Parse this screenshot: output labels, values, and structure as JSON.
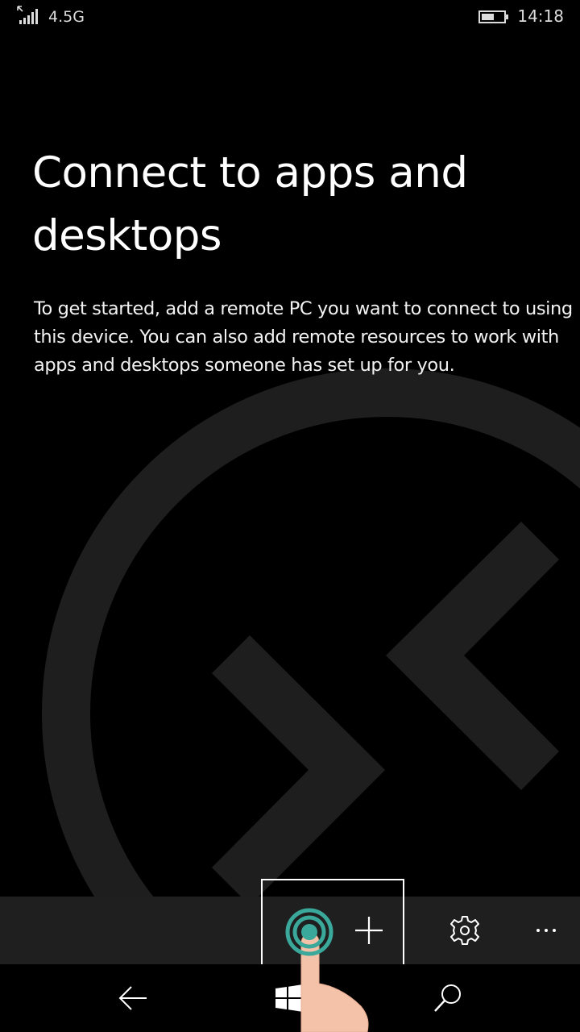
{
  "status_bar": {
    "network": "4.5G",
    "time": "14:18",
    "signal_icon": "signal-bars-icon",
    "battery_icon": "battery-icon"
  },
  "main": {
    "title": "Connect to apps and desktops",
    "description": "To get started, add a remote PC you want to connect to using this device. You can also add remote resources to work with apps and desktops someone has set up for you."
  },
  "app_bar": {
    "buttons": [
      {
        "icon": "add-icon",
        "label": "Add"
      },
      {
        "icon": "gear-icon",
        "label": "Settings"
      },
      {
        "icon": "more-icon",
        "label": "More"
      }
    ]
  },
  "nav_bar": {
    "buttons": [
      {
        "icon": "back-arrow-icon"
      },
      {
        "icon": "windows-start-icon"
      },
      {
        "icon": "search-icon"
      }
    ]
  },
  "colors": {
    "background": "#000000",
    "app_bar": "#1f1f1f",
    "logo_watermark": "#1e1e1e",
    "tap_ring": "#3aa89a"
  }
}
